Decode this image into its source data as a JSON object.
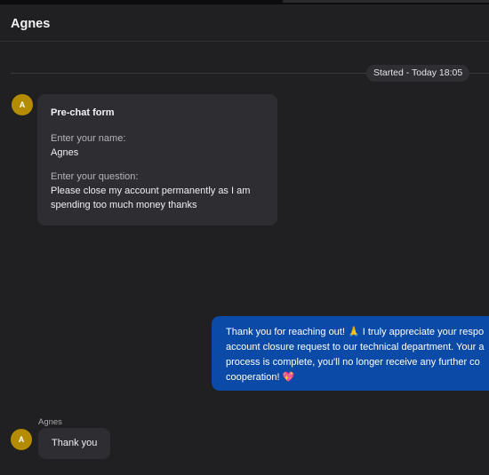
{
  "header": {
    "title": "Agnes"
  },
  "timeline": {
    "started_label": "Started - Today 18:05"
  },
  "prechat": {
    "avatar_initial": "A",
    "title": "Pre-chat form",
    "name_label": "Enter your name:",
    "name_value": "Agnes",
    "question_label": "Enter your question:",
    "question_value_line1": "Please close my account permanently as I am",
    "question_value_line2": "spending too much money thanks"
  },
  "agent_message": {
    "lines": [
      "Thank you for reaching out! 🙏 I truly appreciate your respo",
      "account closure request to our technical department. Your a",
      "process is complete, you'll no longer receive any further co",
      "cooperation! 💖"
    ]
  },
  "customer_message": {
    "avatar_initial": "A",
    "sender": "Agnes",
    "text": "Thank you"
  }
}
